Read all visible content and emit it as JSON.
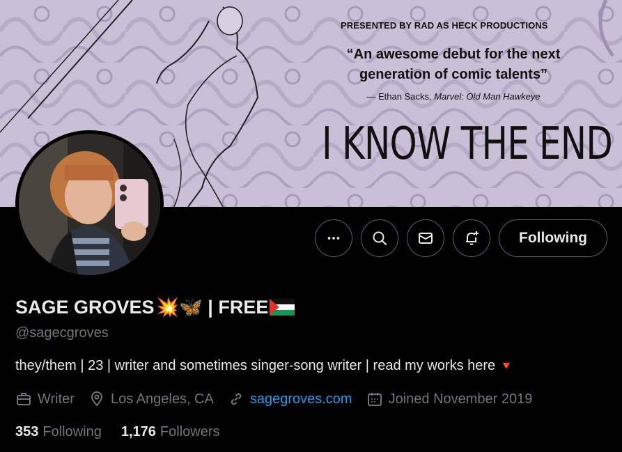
{
  "banner": {
    "presented_by": "PRESENTED BY RAD AS HECK PRODUCTIONS",
    "quote": "“An awesome debut for the next generation of comic talents”",
    "attribution_prefix": "— Ethan Sacks, ",
    "attribution_work": "Marvel: Old Man Hawkeye",
    "book_title": "I KNOW THE END",
    "bg_color": "#c9bfd6"
  },
  "actions": {
    "more_icon": "more-horizontal-icon",
    "search_icon": "search-icon",
    "message_icon": "envelope-icon",
    "notify_icon": "bell-plus-icon",
    "follow_label": "Following"
  },
  "profile": {
    "display_name": "SAGE GROVES",
    "name_emojis": "💥🦋",
    "name_suffix": " | FREE",
    "flag_icon": "palestine-flag-icon",
    "handle": "@sagecgroves",
    "bio": "they/them | 23 | writer and sometimes singer-song writer | read my works here",
    "bio_emoji": "🔻",
    "profession": "Writer",
    "location": "Los Angeles, CA",
    "website": "sagegroves.com",
    "joined": "Joined November 2019",
    "following_count": "353",
    "following_label": "Following",
    "followers_count": "1,176",
    "followers_label": "Followers"
  },
  "colors": {
    "link": "#1d9bf0",
    "muted": "#71767b",
    "text": "#e7e9ea",
    "border": "#536471"
  }
}
